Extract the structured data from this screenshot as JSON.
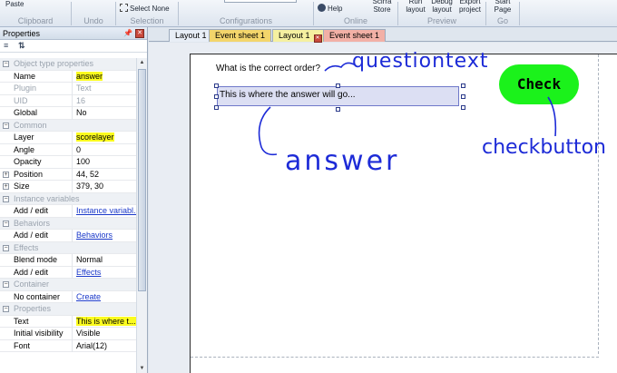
{
  "ribbon": {
    "paste_label": "Paste",
    "select_none_label": "Select None",
    "help_label": "Help",
    "scirra_store_label": "Scirra Store",
    "run_layout_label": "Run layout",
    "debug_layout_label": "Debug layout",
    "export_project_label": "Export project",
    "start_page_label": "Start Page",
    "groups": {
      "clipboard": "Clipboard",
      "undo": "Undo",
      "selection": "Selection",
      "configurations": "Configurations",
      "online": "Online",
      "preview": "Preview",
      "go": "Go"
    }
  },
  "properties": {
    "title": "Properties",
    "sections": {
      "object_type": "Object type properties",
      "common": "Common",
      "instance_variables": "Instance variables",
      "behaviors": "Behaviors",
      "effects": "Effects",
      "container": "Container",
      "properties": "Properties"
    },
    "rows": {
      "name": {
        "key": "Name",
        "value": "answer"
      },
      "plugin": {
        "key": "Plugin",
        "value": "Text"
      },
      "uid": {
        "key": "UID",
        "value": "16"
      },
      "global": {
        "key": "Global",
        "value": "No"
      },
      "layer": {
        "key": "Layer",
        "value": "scorelayer"
      },
      "angle": {
        "key": "Angle",
        "value": "0"
      },
      "opacity": {
        "key": "Opacity",
        "value": "100"
      },
      "position": {
        "key": "Position",
        "value": "44, 52"
      },
      "size": {
        "key": "Size",
        "value": "379, 30"
      },
      "inst_vars": {
        "key": "Add / edit",
        "value": "Instance variabl..."
      },
      "behaviors": {
        "key": "Add / edit",
        "value": "Behaviors"
      },
      "blend": {
        "key": "Blend mode",
        "value": "Normal"
      },
      "effects": {
        "key": "Add / edit",
        "value": "Effects"
      },
      "container": {
        "key": "No container",
        "value": "Create"
      },
      "text": {
        "key": "Text",
        "value": "This is where t..."
      },
      "visibility": {
        "key": "Initial visibility",
        "value": "Visible"
      },
      "font": {
        "key": "Font",
        "value": "Arial(12)"
      }
    }
  },
  "tabs": [
    {
      "label": "Layout 1"
    },
    {
      "label": "Event sheet 1"
    },
    {
      "label": "Layout 1"
    },
    {
      "label": "Event sheet 1"
    }
  ],
  "canvas": {
    "question_text": "What is the correct order?",
    "answer_text": "This is where the answer will go...",
    "check_label": "Check"
  },
  "annotations": {
    "questiontext": "questiontext",
    "answer": "answer",
    "checkbutton": "checkbutton"
  },
  "colors": {
    "highlight": "#fbfb1e",
    "check_button": "#1bf21b",
    "annotation_ink": "#1d2bd7",
    "tab_layout_active": "#f5f0a0",
    "tab_event_sheet": "#f3d56b",
    "tab_event_sheet_active": "#f2b0a6"
  }
}
